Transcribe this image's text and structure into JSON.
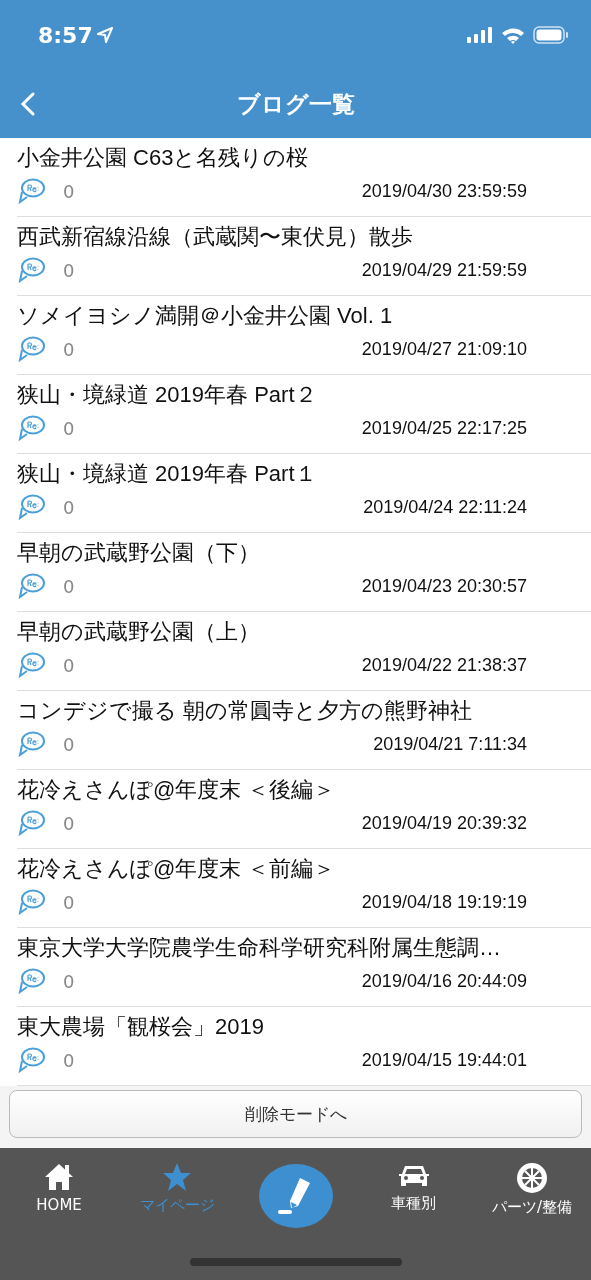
{
  "status_bar": {
    "time": "8:57"
  },
  "header": {
    "title": "ブログ一覧"
  },
  "posts": [
    {
      "title": "小金井公園 C63と名残りの桜",
      "comments": "0",
      "date": "2019/04/30 23:59:59"
    },
    {
      "title": "西武新宿線沿線（武蔵関〜東伏見）散歩",
      "comments": "0",
      "date": "2019/04/29 21:59:59"
    },
    {
      "title": "ソメイヨシノ満開＠小金井公園 Vol. 1",
      "comments": "0",
      "date": "2019/04/27 21:09:10"
    },
    {
      "title": "狭山・境緑道 2019年春 Part２",
      "comments": "0",
      "date": "2019/04/25 22:17:25"
    },
    {
      "title": "狭山・境緑道 2019年春 Part１",
      "comments": "0",
      "date": "2019/04/24 22:11:24"
    },
    {
      "title": "早朝の武蔵野公園（下）",
      "comments": "0",
      "date": "2019/04/23 20:30:57"
    },
    {
      "title": "早朝の武蔵野公園（上）",
      "comments": "0",
      "date": "2019/04/22 21:38:37"
    },
    {
      "title": "コンデジで撮る 朝の常圓寺と夕方の熊野神社",
      "comments": "0",
      "date": "2019/04/21 7:11:34"
    },
    {
      "title": "花冷えさんぽ@年度末 ＜後編＞",
      "comments": "0",
      "date": "2019/04/19 20:39:32"
    },
    {
      "title": "花冷えさんぽ@年度末 ＜前編＞",
      "comments": "0",
      "date": "2019/04/18 19:19:19"
    },
    {
      "title": "東京大学大学院農学生命科学研究科附属生態調…",
      "comments": "0",
      "date": "2019/04/16 20:44:09"
    },
    {
      "title": "東大農場「観桜会」2019",
      "comments": "0",
      "date": "2019/04/15 19:44:01"
    }
  ],
  "delete_button": {
    "label": "削除モードへ"
  },
  "tab_bar": [
    {
      "kind": "home",
      "label": "HOME",
      "selected": false
    },
    {
      "kind": "star",
      "label": "マイページ",
      "selected": true
    },
    {
      "kind": "compose",
      "selected": false
    },
    {
      "kind": "car",
      "label": "車種別",
      "selected": false
    },
    {
      "kind": "wheel",
      "label": "パーツ/整備",
      "selected": false
    }
  ]
}
